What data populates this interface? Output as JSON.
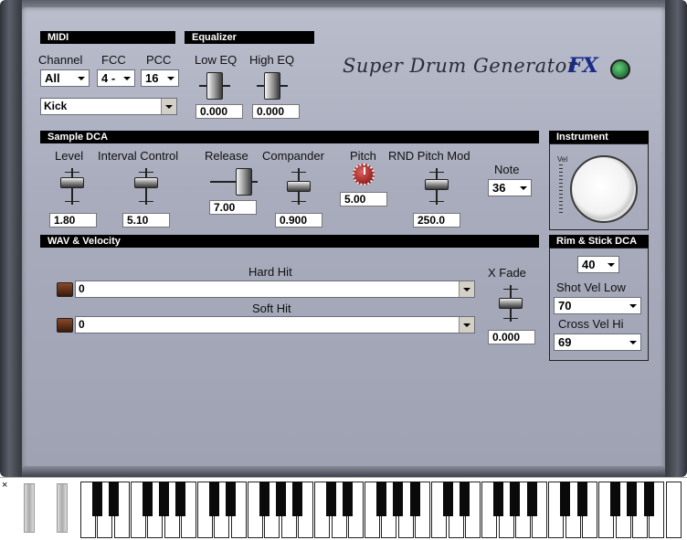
{
  "title": "Super Drum Generator",
  "title_suffix": "FX",
  "sections": {
    "midi": "MIDI",
    "equalizer": "Equalizer",
    "sample_dca": "Sample DCA",
    "instrument": "Instrument",
    "wav_velocity": "WAV & Velocity",
    "rim_stick": "Rim & Stick DCA"
  },
  "midi": {
    "channel_label": "Channel",
    "channel_value": "All",
    "fcc_label": "FCC",
    "fcc_value": "4 -",
    "pcc_label": "PCC",
    "pcc_value": "16",
    "drum_value": "Kick"
  },
  "equalizer": {
    "low_label": "Low EQ",
    "low_value": "0.000",
    "high_label": "High EQ",
    "high_value": "0.000"
  },
  "sample_dca": {
    "level_label": "Level",
    "level_value": "1.80",
    "interval_label": "Interval Control",
    "interval_value": "5.10",
    "release_label": "Release",
    "release_value": "7.00",
    "compander_label": "Compander",
    "compander_value": "0.900",
    "pitch_label": "Pitch",
    "pitch_value": "5.00",
    "rnd_label": "RND Pitch Mod",
    "rnd_value": "250.0",
    "note_label": "Note",
    "note_value": "36"
  },
  "instrument": {
    "vel_label": "Vel"
  },
  "wav": {
    "hard_label": "Hard Hit",
    "hard_value": "0",
    "soft_label": "Soft Hit",
    "soft_value": "0",
    "xfade_label": "X Fade",
    "xfade_value": "0.000"
  },
  "rim": {
    "value": "40",
    "shot_label": "Shot Vel Low",
    "shot_value": "70",
    "cross_label": "Cross Vel Hi",
    "cross_value": "69"
  },
  "keyboard": {
    "close_glyph": "×"
  }
}
